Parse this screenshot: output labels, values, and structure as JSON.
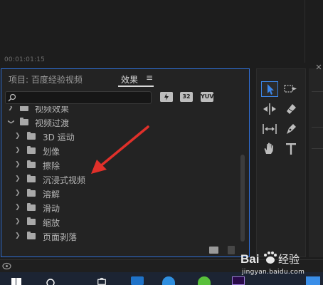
{
  "monitor": {
    "timecode": "00:01:01:15"
  },
  "panel": {
    "tab_project": "项目: 百度经验视频",
    "tab_effects": "效果",
    "tab_menu": "≡",
    "buttons": [
      "",
      "32",
      "YUV"
    ]
  },
  "tree": {
    "rows": [
      {
        "label": "视频效果",
        "expanded": false,
        "level": 0
      },
      {
        "label": "视频过渡",
        "expanded": true,
        "level": 0
      },
      {
        "label": "3D 运动",
        "expanded": false,
        "level": 1
      },
      {
        "label": "划像",
        "expanded": false,
        "level": 1
      },
      {
        "label": "擦除",
        "expanded": false,
        "level": 1
      },
      {
        "label": "沉浸式视频",
        "expanded": false,
        "level": 1
      },
      {
        "label": "溶解",
        "expanded": false,
        "level": 1
      },
      {
        "label": "滑动",
        "expanded": false,
        "level": 1
      },
      {
        "label": "缩放",
        "expanded": false,
        "level": 1
      },
      {
        "label": "页面剥落",
        "expanded": false,
        "level": 1
      }
    ]
  },
  "tools": [
    "selection-tool",
    "track-select-tool",
    "ripple-edit-tool",
    "razor-tool",
    "slip-tool",
    "pen-tool",
    "hand-tool",
    "type-tool"
  ],
  "watermark": {
    "site": "jingyan.baidu.com"
  },
  "colors": {
    "panel_border": "#2f6fd6",
    "arrow": "#e0302a"
  }
}
